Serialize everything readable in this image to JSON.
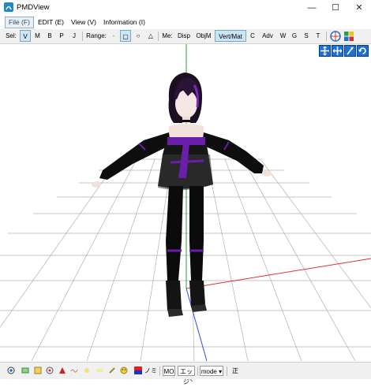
{
  "window": {
    "title": "PMDView"
  },
  "menu": {
    "items": [
      "File (F)",
      "EDIT (E)",
      "View (V)",
      "Information (I)"
    ]
  },
  "toolbar": {
    "sel_label": "Sel:",
    "sel_buttons": [
      "V",
      "M",
      "B",
      "P",
      "J"
    ],
    "range_label": "Range:",
    "range_buttons": [
      "·",
      "▢",
      "○",
      "△"
    ],
    "me_label": "Me:",
    "me_buttons": [
      "Disp",
      "ObjM",
      "Vert/Mat",
      "C",
      "Adv",
      "W",
      "G",
      "S",
      "T"
    ]
  },
  "statusbar": {
    "nomi_label": "ノミ",
    "mo_label": "MO",
    "eff_label": "エッジ̀",
    "mode_label": "mode",
    "right_label": "正"
  },
  "colors": {
    "accent_blue": "#1e6fd1",
    "axis_x": "#e03030",
    "axis_y": "#2fa02f",
    "axis_z": "#3050e0",
    "grid": "#b0b0b0",
    "outfit_purple": "#6a1fa8"
  }
}
